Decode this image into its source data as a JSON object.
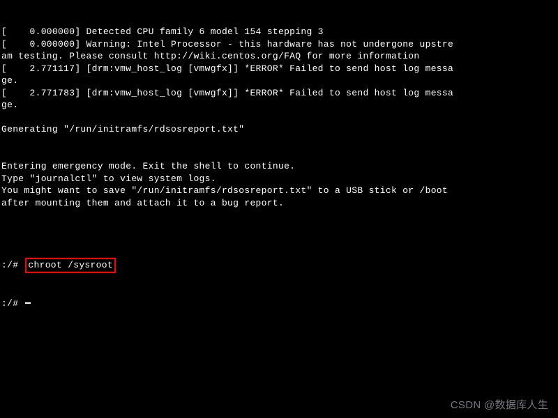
{
  "boot_lines": [
    "[    0.000000] Detected CPU family 6 model 154 stepping 3",
    "[    0.000000] Warning: Intel Processor - this hardware has not undergone upstre",
    "am testing. Please consult http://wiki.centos.org/FAQ for more information",
    "[    2.771117] [drm:vmw_host_log [vmwgfx]] *ERROR* Failed to send host log messa",
    "ge.",
    "[    2.771783] [drm:vmw_host_log [vmwgfx]] *ERROR* Failed to send host log messa",
    "ge.",
    "",
    "Generating \"/run/initramfs/rdsosreport.txt\"",
    "",
    "",
    "Entering emergency mode. Exit the shell to continue.",
    "Type \"journalctl\" to view system logs.",
    "You might want to save \"/run/initramfs/rdsosreport.txt\" to a USB stick or /boot",
    "after mounting them and attach it to a bug report.",
    "",
    ""
  ],
  "prompt1": {
    "prefix": ":/# ",
    "command": "chroot /sysroot"
  },
  "prompt2": {
    "prefix": ":/# "
  },
  "watermark": "CSDN @数据库人生"
}
